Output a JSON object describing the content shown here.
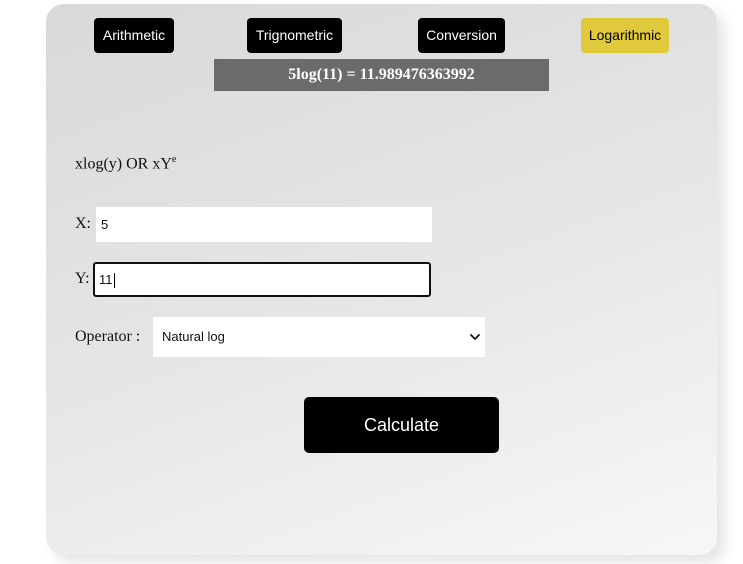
{
  "tabs": [
    {
      "label": "Arithmetic",
      "active": false
    },
    {
      "label": "Trignometric",
      "active": false
    },
    {
      "label": "Conversion",
      "active": false
    },
    {
      "label": "Logarithmic",
      "active": true
    }
  ],
  "result_text": "5log(11) = 11.989476363992",
  "formula": {
    "text": "xlog(y) OR xY",
    "superscript": "e"
  },
  "fields": {
    "x": {
      "label": "X:",
      "value": "5"
    },
    "y": {
      "label": "Y:",
      "value": "11"
    }
  },
  "operator": {
    "label": "Operator :",
    "selected": "Natural log"
  },
  "calculate_label": "Calculate",
  "colors": {
    "active_tab": "#e0c93a",
    "tab": "#000000",
    "result_bg": "#6b6b6b"
  }
}
